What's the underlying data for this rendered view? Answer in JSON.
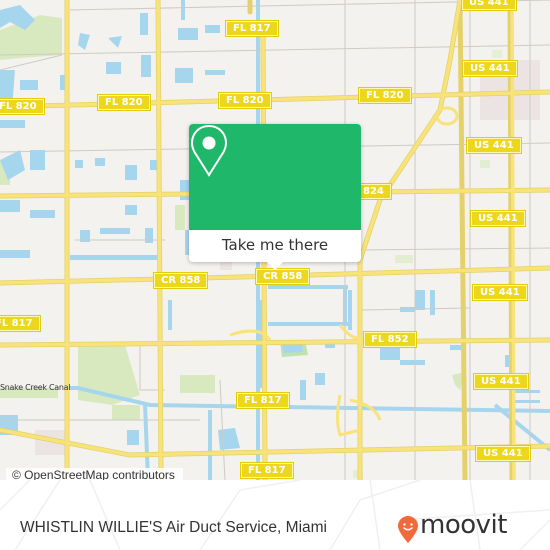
{
  "map": {
    "attribution": "© OpenStreetMap contributors",
    "water_labels": [
      "Snake Creek Canal"
    ],
    "road_shields": [
      {
        "label": "US 441"
      },
      {
        "label": "FL 817"
      },
      {
        "label": "US 441"
      },
      {
        "label": "FL 820"
      },
      {
        "label": "FL 820"
      },
      {
        "label": "FL 820"
      },
      {
        "label": "US 441"
      },
      {
        "label": "824"
      },
      {
        "label": "US 441"
      },
      {
        "label": "CR 858"
      },
      {
        "label": "CR 858"
      },
      {
        "label": "US 441"
      },
      {
        "label": "FL 852"
      },
      {
        "label": "US 441"
      },
      {
        "label": "FL 817"
      },
      {
        "label": "FL 817"
      },
      {
        "label": "US 441"
      }
    ],
    "colors": {
      "land": "#f3f2ee",
      "water": "#a6d6ee",
      "park": "#d4e8b8",
      "major_road": "#f8e37a",
      "shield": "#ecd71d"
    }
  },
  "popup": {
    "icon": "map-pin-icon",
    "button_label": "Take me there",
    "color": "#1fb86a"
  },
  "footer": {
    "title": "WHISTLIN WILLIE'S Air Duct Service, Miami",
    "logo_text": "moovit",
    "logo_color": "#f26a3b"
  }
}
